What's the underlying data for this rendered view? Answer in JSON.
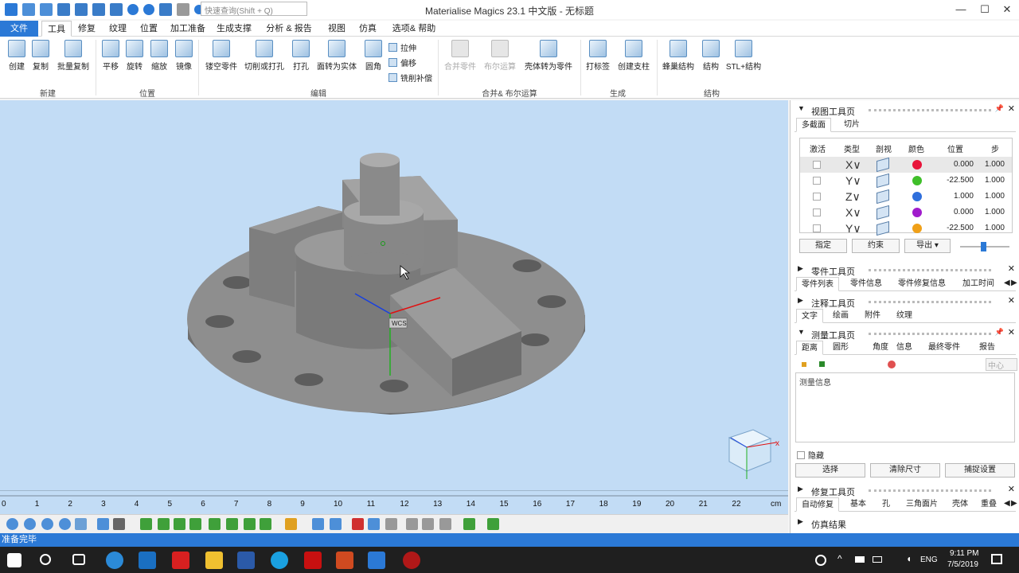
{
  "window": {
    "title": "Materialise Magics 23.1 中文版 - 无标题",
    "quick_search_placeholder": "快速查询(Shift + Q)",
    "minimize": "—",
    "maximize": "☐",
    "close": "✕"
  },
  "menu": {
    "tabs": [
      "文件",
      "工具",
      "修复",
      "纹理",
      "位置",
      "加工准备",
      "生成支撑",
      "分析 & 报告",
      "视图",
      "仿真",
      "选项& 帮助"
    ]
  },
  "ribbon": {
    "buttons": [
      "创建",
      "复制",
      "批量复制",
      "平移",
      "旋转",
      "缩放",
      "镜像",
      "镂空零件",
      "切削或打孔",
      "打孔",
      "面转为实体",
      "圆角",
      "合并零件",
      "布尔运算",
      "壳体转为零件",
      "打标签",
      "创建支柱",
      "蜂巢结构",
      "结构",
      "STL+结构"
    ],
    "small_buttons": [
      "拉伸",
      "偏移",
      "铣削补偿"
    ],
    "groups": [
      "新建",
      "位置",
      "编辑",
      "合并& 布尔运算",
      "生成",
      "结构"
    ]
  },
  "viewport": {
    "wcs_label": "WCS",
    "ruler_ticks": [
      "0",
      "1",
      "2",
      "3",
      "4",
      "5",
      "6",
      "7",
      "8",
      "9",
      "10",
      "11",
      "12",
      "13",
      "14",
      "15",
      "16",
      "17",
      "18",
      "19",
      "20",
      "21",
      "22"
    ],
    "ruler_unit": "cm",
    "colors": {
      "background": "#c2dcf5",
      "part": "#8c8c8c"
    }
  },
  "status": {
    "text": "准备完毕"
  },
  "taskbar": {
    "lang": "ENG",
    "time": "9:11 PM",
    "date": "7/5/2019"
  },
  "view_panel": {
    "title": "视图工具页",
    "tabs": [
      "多截面",
      "切片"
    ],
    "columns": [
      "激活",
      "类型",
      "剖视",
      "颜色",
      "位置",
      "步"
    ],
    "rows": [
      {
        "type": "X∨",
        "color": "#e8143a",
        "position": "0.000",
        "step": "1.000"
      },
      {
        "type": "Y∨",
        "color": "#3fbf2a",
        "position": "-22.500",
        "step": "1.000"
      },
      {
        "type": "Z∨",
        "color": "#2f6fdc",
        "position": "1.000",
        "step": "1.000"
      },
      {
        "type": "X∨",
        "color": "#a01ccc",
        "position": "0.000",
        "step": "1.000"
      },
      {
        "type": "Y∨",
        "color": "#f0a018",
        "position": "-22.500",
        "step": "1.000"
      }
    ],
    "buttons": {
      "assign": "指定",
      "constrain": "约束",
      "export": "导出"
    }
  },
  "parts_panel": {
    "title": "零件工具页",
    "tabs": [
      "零件列表",
      "零件信息",
      "零件修复信息",
      "加工时间估"
    ]
  },
  "annotation_panel": {
    "title": "注释工具页",
    "tabs": [
      "文字",
      "绘画",
      "附件",
      "纹理"
    ]
  },
  "measure_panel": {
    "title": "测量工具页",
    "tabs": [
      "距离",
      "圆形",
      "角度",
      "信息",
      "最终零件",
      "报告"
    ],
    "center_label": "中心",
    "info_label": "测量信息",
    "hide_label": "隐藏",
    "buttons": {
      "select": "选择",
      "clear": "清除尺寸",
      "snap": "捕捉设置"
    }
  },
  "fix_panel": {
    "title": "修复工具页",
    "tabs": [
      "自动修复",
      "基本",
      "孔",
      "三角面片",
      "壳体",
      "重叠"
    ]
  },
  "sim_panel": {
    "title": "仿真结果"
  }
}
